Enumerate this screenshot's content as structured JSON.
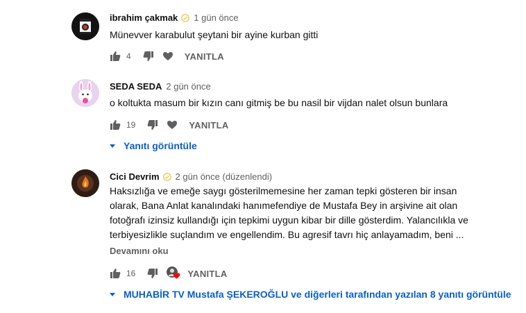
{
  "comments": [
    {
      "author": "ibrahim çakmak",
      "verified": true,
      "time": "1 gün önce",
      "text": "Münevver karabulut şeytani bir ayine kurban gitti",
      "likes": "4",
      "reply_label": "YANITLA",
      "avatar": "besiktas-logo-avatar"
    },
    {
      "author": "SEDA SEDA",
      "verified": false,
      "time": "2 gün önce",
      "text": "o koltukta masum bir kızın canı gitmiş be bu nasil bir vijdan nalet olsun bunlara",
      "likes": "19",
      "reply_label": "YANITLA",
      "avatar": "bunny-avatar",
      "view_replies": "Yanıtı görüntüle"
    },
    {
      "author": "Cici Devrim",
      "verified": true,
      "time": "2 gün önce (düzenlendi)",
      "text_lines": [
        "Haksızlığa ve emeğe saygı gösterilmemesine her zaman tepki gösteren bir insan",
        "olarak, Bana Anlat kanalındaki hanımefendiye de Mustafa Bey in arşivine ait olan",
        "fotoğrafı izinsiz kullandığı için tepkimi uygun kibar bir dille gösterdim. Yalancılıkla ve",
        "terbiyesizlikle suçlandım ve engellendim. Bu agresif tavrı hiç anlayamadım,  beni ..."
      ],
      "read_more": "Devamını oku",
      "likes": "16",
      "reply_label": "YANITLA",
      "avatar": "fire-avatar",
      "view_replies": "MUHABİR TV Mustafa ŞEKEROĞLU ve diğerleri tarafından yazılan 8 yanıtı görüntüle"
    }
  ],
  "colors": {
    "link": "#065fd4",
    "muted": "#606060",
    "verified": "#f2c94c",
    "heart": "#ff0000"
  }
}
